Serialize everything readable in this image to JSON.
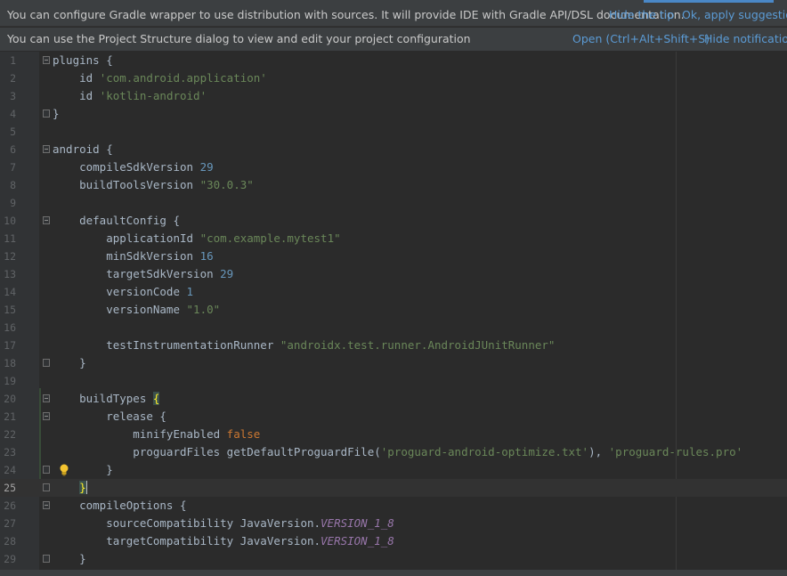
{
  "notifications": {
    "gradle_tip": {
      "message": "You can configure Gradle wrapper to use distribution with sources. It will provide IDE with Gradle API/DSL documentation.",
      "hide_label": "Hide the tip",
      "apply_label": "Ok, apply suggestion!"
    },
    "project_structure": {
      "message": "You can use the Project Structure dialog to view and edit your project configuration",
      "open_label": "Open (Ctrl+Alt+Shift+S)",
      "hide_label": "Hide notification"
    }
  },
  "editor": {
    "current_line": 25,
    "lines": [
      {
        "n": "1",
        "code": "plugins {"
      },
      {
        "n": "2",
        "code": "    id 'com.android.application'"
      },
      {
        "n": "3",
        "code": "    id 'kotlin-android'"
      },
      {
        "n": "4",
        "code": "}"
      },
      {
        "n": "5",
        "code": ""
      },
      {
        "n": "6",
        "code": "android {"
      },
      {
        "n": "7",
        "code": "    compileSdkVersion 29"
      },
      {
        "n": "8",
        "code": "    buildToolsVersion \"30.0.3\""
      },
      {
        "n": "9",
        "code": ""
      },
      {
        "n": "10",
        "code": "    defaultConfig {"
      },
      {
        "n": "11",
        "code": "        applicationId \"com.example.mytest1\""
      },
      {
        "n": "12",
        "code": "        minSdkVersion 16"
      },
      {
        "n": "13",
        "code": "        targetSdkVersion 29"
      },
      {
        "n": "14",
        "code": "        versionCode 1"
      },
      {
        "n": "15",
        "code": "        versionName \"1.0\""
      },
      {
        "n": "16",
        "code": ""
      },
      {
        "n": "17",
        "code": "        testInstrumentationRunner \"androidx.test.runner.AndroidJUnitRunner\""
      },
      {
        "n": "18",
        "code": "    }"
      },
      {
        "n": "19",
        "code": ""
      },
      {
        "n": "20",
        "code": "    buildTypes {"
      },
      {
        "n": "21",
        "code": "        release {"
      },
      {
        "n": "22",
        "code": "            minifyEnabled false"
      },
      {
        "n": "23",
        "code": "            proguardFiles getDefaultProguardFile('proguard-android-optimize.txt'), 'proguard-rules.pro'"
      },
      {
        "n": "24",
        "code": "        }"
      },
      {
        "n": "25",
        "code": "    }"
      },
      {
        "n": "26",
        "code": "    compileOptions {"
      },
      {
        "n": "27",
        "code": "        sourceCompatibility JavaVersion.VERSION_1_8"
      },
      {
        "n": "28",
        "code": "        targetCompatibility JavaVersion.VERSION_1_8"
      },
      {
        "n": "29",
        "code": "    }"
      }
    ]
  },
  "colors": {
    "background": "#2b2b2b",
    "gutter": "#313335",
    "keyword": "#cc7832",
    "number": "#6897bb",
    "string": "#6a8759",
    "static_field": "#9876aa",
    "link": "#5b9bd5"
  }
}
